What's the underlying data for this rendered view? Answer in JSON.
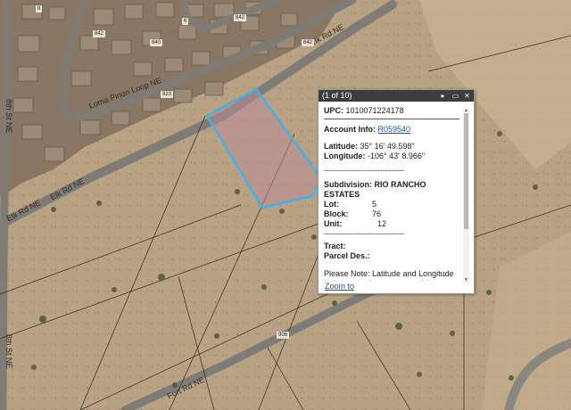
{
  "map": {
    "road_labels": {
      "loma_pinon_loop": "Loma Pinon Loop NE",
      "elk_rd_upper": "Elk Rd NE",
      "elk_rd_lower_1": "Elk Rd NE",
      "elk_rd_lower_2": "Elk Rd NE",
      "eighth_st_upper": "8th St NE",
      "eighth_st_lower": "8th St NE",
      "fort_rd": "Fort Rd NE"
    },
    "shields": {
      "s1": "8",
      "s2": "6",
      "s3": "842",
      "s4": "842",
      "s5": "840",
      "s6": "823",
      "s7": "842",
      "s8": "906"
    },
    "colors": {
      "terrain": "#b9a283",
      "road": "#7f7c76",
      "parcel_outline": "#3fb3e6",
      "parcel_fill": "#b98a96"
    }
  },
  "popup": {
    "pager": "(1 of 10)",
    "controls": {
      "next": "▸",
      "maximize": "▭",
      "close": "✕"
    },
    "upc_label": "UPC:",
    "upc_value": "1010071224178",
    "account_label": "Account Info:",
    "account_value": "R059540",
    "latitude_label": "Latitude:",
    "latitude_value": "35° 16' 49.598\"",
    "longitude_label": "Longitude:",
    "longitude_value": "-106° 43' 8.966\"",
    "separator1": "------------------------------",
    "subdivision_label": "Subdivision:",
    "subdivision_value": "RIO RANCHO ESTATES",
    "lot_label": "Lot:",
    "lot_value": "5",
    "block_label": "Block:",
    "block_value": "76",
    "unit_label": "Unit:",
    "unit_value": "12",
    "separator2": "------------------------------",
    "tract_label": "Tract:",
    "parcel_des_label": "Parcel Des.:",
    "note": "Please Note: Latitude and Longitude is the approximate center of the parcel shown.",
    "zoom_link": "Zoom to"
  }
}
